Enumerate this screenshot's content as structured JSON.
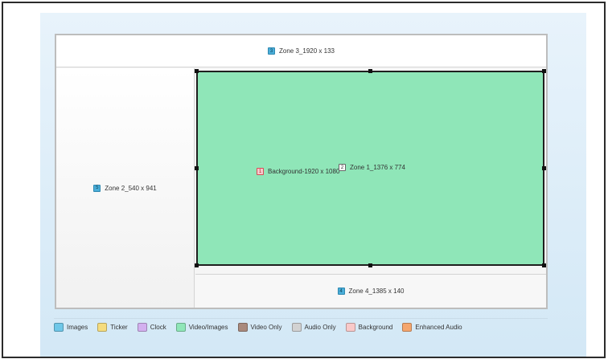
{
  "zones": {
    "zone3": {
      "number": "3",
      "label": "Zone 3_1920 x 133"
    },
    "zone2": {
      "number": "5",
      "label": "Zone 2_540 x 941"
    },
    "zone1": {
      "number": "2",
      "label": "Zone 1_1376 x 774"
    },
    "zone4": {
      "number": "4",
      "label": "Zone 4_1385 x 140"
    },
    "background": {
      "number": "1",
      "label": "Background-1920 x 1080"
    }
  },
  "legend": [
    {
      "label": "Images",
      "color": "#6fc7e8"
    },
    {
      "label": "Ticker",
      "color": "#f5dc7e"
    },
    {
      "label": "Clock",
      "color": "#d3b0ef"
    },
    {
      "label": "Video/Images",
      "color": "#8fe6b8"
    },
    {
      "label": "Video Only",
      "color": "#a98a7d"
    },
    {
      "label": "Audio Only",
      "color": "#d2d2d2"
    },
    {
      "label": "Background",
      "color": "#f9c9c9"
    },
    {
      "label": "Enhanced Audio",
      "color": "#f5a66e"
    }
  ]
}
